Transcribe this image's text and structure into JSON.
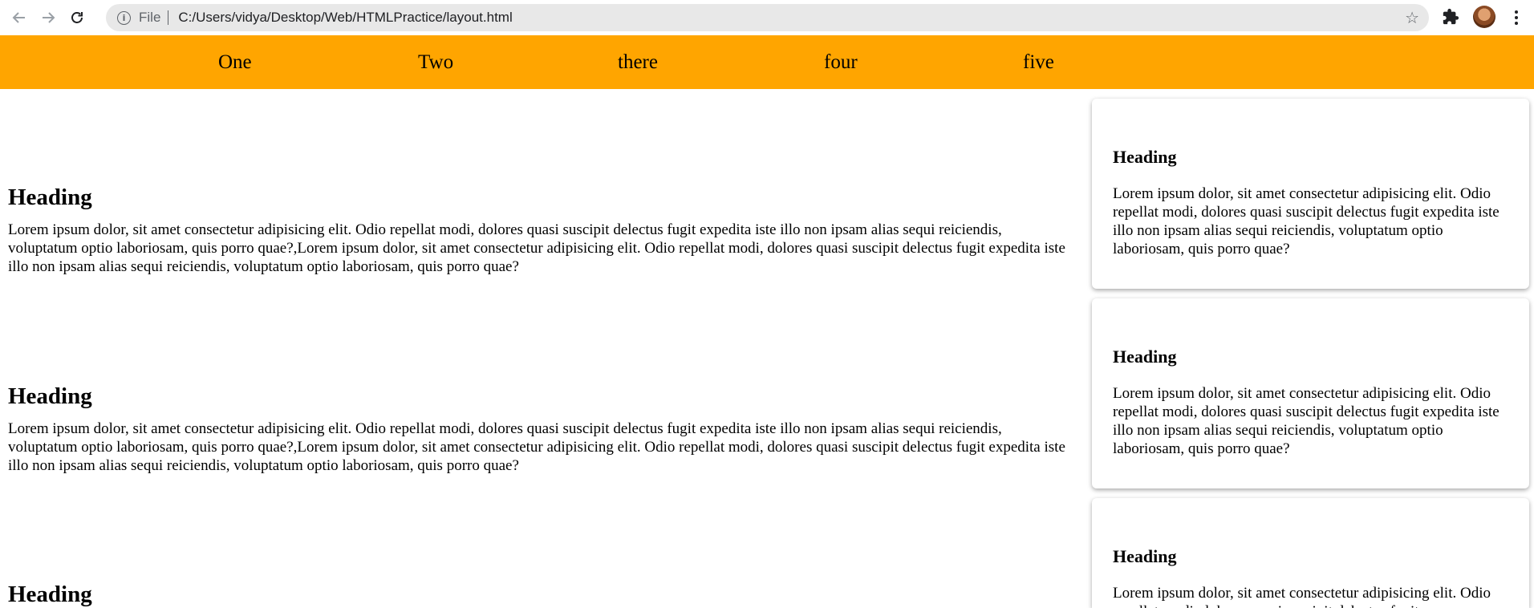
{
  "browser": {
    "scheme_label": "File",
    "url": "C:/Users/vidya/Desktop/Web/HTMLPractice/layout.html",
    "icons": {
      "back": "arrow-left-icon",
      "forward": "arrow-right-icon",
      "reload": "reload-icon",
      "info": "info-icon",
      "bookmark": "star-icon",
      "extensions": "puzzle-icon",
      "menu": "kebab-menu-icon"
    }
  },
  "navbar": {
    "background": "#ffa500",
    "links": [
      "One",
      "Two",
      "there",
      "four",
      "five"
    ]
  },
  "main": {
    "sections": [
      {
        "heading": "Heading",
        "body": "Lorem ipsum dolor, sit amet consectetur adipisicing elit. Odio repellat modi, dolores quasi suscipit delectus fugit expedita iste illo non ipsam alias sequi reiciendis, voluptatum optio laboriosam, quis porro quae?,Lorem ipsum dolor, sit amet consectetur adipisicing elit. Odio repellat modi, dolores quasi suscipit delectus fugit expedita iste illo non ipsam alias sequi reiciendis, voluptatum optio laboriosam, quis porro quae?"
      },
      {
        "heading": "Heading",
        "body": "Lorem ipsum dolor, sit amet consectetur adipisicing elit. Odio repellat modi, dolores quasi suscipit delectus fugit expedita iste illo non ipsam alias sequi reiciendis, voluptatum optio laboriosam, quis porro quae?,Lorem ipsum dolor, sit amet consectetur adipisicing elit. Odio repellat modi, dolores quasi suscipit delectus fugit expedita iste illo non ipsam alias sequi reiciendis, voluptatum optio laboriosam, quis porro quae?"
      },
      {
        "heading": "Heading"
      }
    ]
  },
  "sidebar": {
    "cards": [
      {
        "heading": "Heading",
        "body": "Lorem ipsum dolor, sit amet consectetur adipisicing elit. Odio repellat modi, dolores quasi suscipit delectus fugit expedita iste illo non ipsam alias sequi reiciendis, voluptatum optio laboriosam, quis porro quae?"
      },
      {
        "heading": "Heading",
        "body": "Lorem ipsum dolor, sit amet consectetur adipisicing elit. Odio repellat modi, dolores quasi suscipit delectus fugit expedita iste illo non ipsam alias sequi reiciendis, voluptatum optio laboriosam, quis porro quae?"
      },
      {
        "heading": "Heading",
        "body": "Lorem ipsum dolor, sit amet consectetur adipisicing elit. Odio repellat modi, dolores quasi suscipit delectus fugit"
      }
    ]
  }
}
